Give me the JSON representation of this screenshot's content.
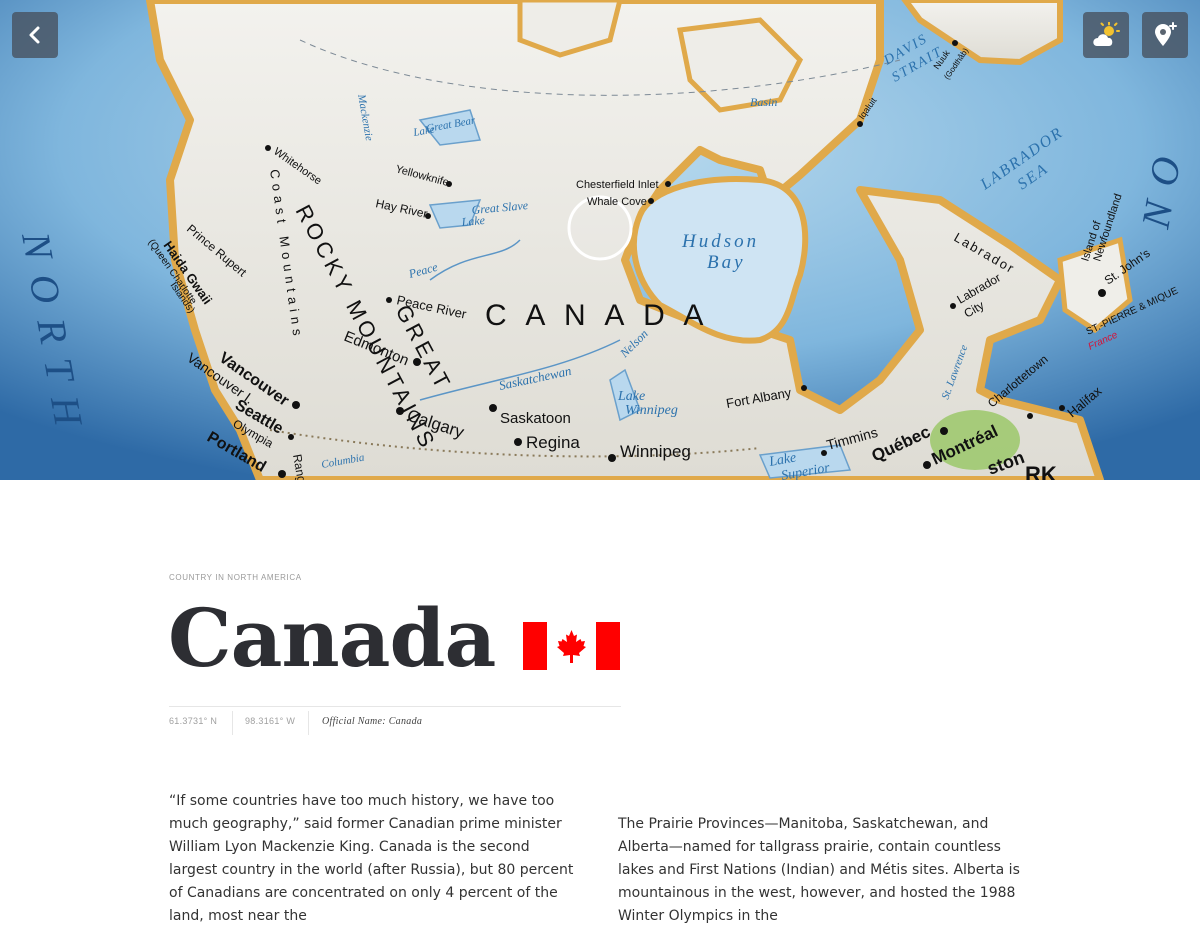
{
  "toolbar": {
    "back_icon": "chevron-left-icon",
    "weather_icon": "partly-cloudy-icon",
    "pin_icon": "add-location-pin-icon"
  },
  "map": {
    "labels": {
      "canada": "C A N A D A",
      "rocky_mountains": "ROCKY MOUNTAINS",
      "great": "GREAT",
      "coast_mountains": "Coast Mountains",
      "hudson": "Hudson",
      "bay": "Bay",
      "labrador_sea_1": "LABRADOR",
      "labrador_sea_2": "SEA",
      "davis_1": "DAVIS",
      "davis_2": "STRAIT",
      "basin": "Basin",
      "great_bear": "Great Bear",
      "lake_gb": "Lake",
      "great_slave": "Great Slave",
      "lake_gs": "Lake",
      "peace": "Peace",
      "saskatchewan": "Saskatchewan",
      "nelson": "Nelson",
      "lake_winnipeg_1": "Lake",
      "lake_winnipeg_2": "Winnipeg",
      "lake_superior_1": "Lake",
      "lake_superior_2": "Superior",
      "labrador": "Labrador",
      "mackenzie": "Mackenzie",
      "columbia": "Columbia",
      "st_lawrence": "St. Lawrence",
      "island_nf_1": "Island of",
      "island_nf_2": "Newfoundland",
      "st_pierre": "ST.-PIERRE & MIQUE",
      "france": "France",
      "north": "NORTH",
      "no": "NO"
    },
    "cities": {
      "whitehorse": "Whitehorse",
      "yellowknife": "Yellowknife",
      "hay_river": "Hay River",
      "chesterfield": "Chesterfield Inlet",
      "whale_cove": "Whale Cove",
      "prince_rupert": "Prince Rupert",
      "haida_gwaii": "Haida Gwaii",
      "queen_charlotte_1": "(Queen Charlotte",
      "queen_charlotte_2": "Islands)",
      "peace_river": "Peace River",
      "edmonton": "Edmonton",
      "calgary": "Calgary",
      "saskatoon": "Saskatoon",
      "regina": "Regina",
      "winnipeg": "Winnipeg",
      "vancouver": "Vancouver",
      "vancouver_i": "Vancouver I.",
      "seattle": "Seattle",
      "olympia": "Olympia",
      "portland": "Portland",
      "fort_albany": "Fort Albany",
      "timmins": "Timmins",
      "quebec": "Québec",
      "montreal": "Montréal",
      "charlottetown": "Charlottetown",
      "halifax": "Halifax",
      "labrador_city_1": "Labrador",
      "labrador_city_2": "City",
      "st_johns": "St. John's",
      "iqaluit": "Iqaluit",
      "nuuk_1": "Nuuk",
      "nuuk_2": "(Godthåb)",
      "ston": "ston",
      "rk": "RK",
      "range": "Range"
    }
  },
  "article": {
    "kicker": "COUNTRY IN NORTH AMERICA",
    "title": "Canada",
    "flag_icon": "canada-flag",
    "latitude": "61.3731° N",
    "longitude": "98.3161° W",
    "official_name": "Official Name: Canada",
    "paragraph_left": "“If some countries have too much history, we have too much geography,” said former Canadian prime minister William Lyon Mackenzie King. Canada is the second largest country in the world (after Russia), but 80 percent of Canadians are concentrated on only 4 percent of the land, most near the",
    "paragraph_right": "The Prairie Provinces—Manitoba, Saskatchewan, and Alberta—named for tallgrass prairie, contain countless lakes and First Nations (Indian) and Métis sites. Alberta is mountainous in the west, however, and hosted the 1988 Winter Olympics in the"
  },
  "colors": {
    "ocean": "#2f6fa8",
    "land": "#e9e8e3",
    "coast": "#e0a94a",
    "flag_red": "#ff0000",
    "title": "#2d2e33"
  }
}
